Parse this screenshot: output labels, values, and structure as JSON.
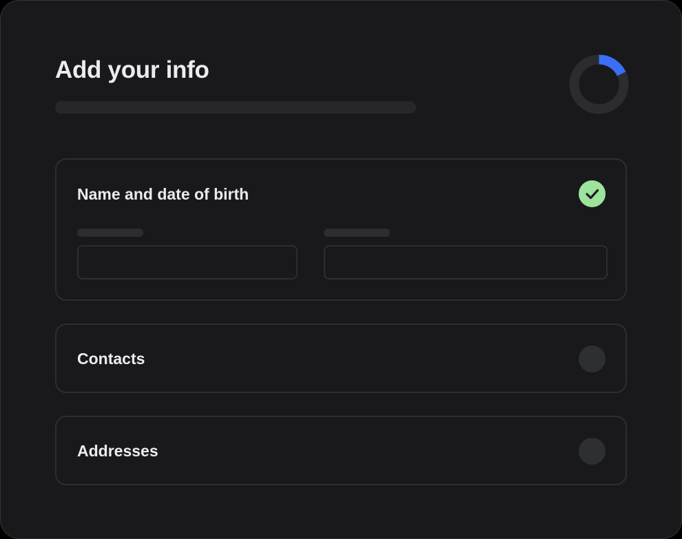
{
  "header": {
    "title": "Add your info",
    "progress_fraction": 0.18
  },
  "sections": [
    {
      "title": "Name and date of birth",
      "status": "complete",
      "status_icon": "check-icon"
    },
    {
      "title": "Contacts",
      "status": "incomplete"
    },
    {
      "title": "Addresses",
      "status": "incomplete"
    }
  ],
  "colors": {
    "background": "#19191c",
    "accent": "#3b6ff5",
    "success": "#9de39c",
    "text": "#ececee"
  }
}
